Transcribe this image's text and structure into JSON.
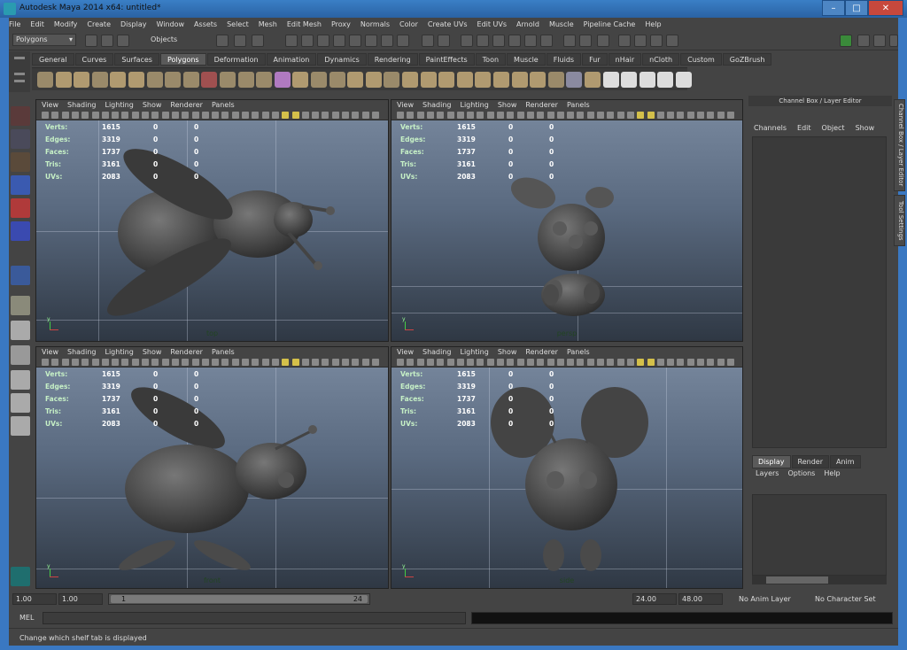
{
  "window": {
    "title": "Autodesk Maya 2014 x64: untitled*",
    "min": "–",
    "max": "□",
    "close": "✕"
  },
  "menubar": [
    "File",
    "Edit",
    "Modify",
    "Create",
    "Display",
    "Window",
    "Assets",
    "Select",
    "Mesh",
    "Edit Mesh",
    "Proxy",
    "Normals",
    "Color",
    "Create UVs",
    "Edit UVs",
    "Arnold",
    "Muscle",
    "Pipeline Cache",
    "Help"
  ],
  "status": {
    "mode": "Polygons",
    "objects_label": "Objects"
  },
  "shelf": {
    "tabs": [
      "General",
      "Curves",
      "Surfaces",
      "Polygons",
      "Deformation",
      "Animation",
      "Dynamics",
      "Rendering",
      "PaintEffects",
      "Toon",
      "Muscle",
      "Fluids",
      "Fur",
      "nHair",
      "nCloth",
      "Custom",
      "GoZBrush"
    ],
    "active": "Polygons"
  },
  "viewport_menu": [
    "View",
    "Shading",
    "Lighting",
    "Show",
    "Renderer",
    "Panels"
  ],
  "hud": {
    "labels": [
      "Verts:",
      "Edges:",
      "Faces:",
      "Tris:",
      "UVs:"
    ],
    "v1": [
      "1615",
      "3319",
      "1737",
      "3161",
      "2083"
    ],
    "v2": [
      "0",
      "0",
      "0",
      "0",
      "0"
    ],
    "v3": [
      "0",
      "0",
      "0",
      "0",
      "0"
    ]
  },
  "viewports": {
    "top": "top",
    "persp": "persp",
    "front": "front",
    "side": "side"
  },
  "channel_box": {
    "title": "Channel Box / Layer Editor",
    "menu": [
      "Channels",
      "Edit",
      "Object",
      "Show"
    ]
  },
  "side_tabs": [
    "Channel Box / Layer Editor",
    "Tool Settings"
  ],
  "layer_editor": {
    "tabs": [
      "Display",
      "Render",
      "Anim"
    ],
    "active": "Display",
    "menu": [
      "Layers",
      "Options",
      "Help"
    ]
  },
  "timeline": {
    "start_time": "1.00",
    "playback_start": "1.00",
    "range_start": "1",
    "range_end": "24",
    "playback_end": "24.00",
    "end_time": "48.00",
    "anim_layer": "No Anim Layer",
    "char_set": "No Character Set"
  },
  "cmdline": {
    "label": "MEL"
  },
  "helpline": {
    "text": "Change which shelf tab is displayed"
  },
  "colors": {
    "accent": "#3a78c2",
    "hud_label": "#c6f0c6",
    "panel": "#444444"
  }
}
